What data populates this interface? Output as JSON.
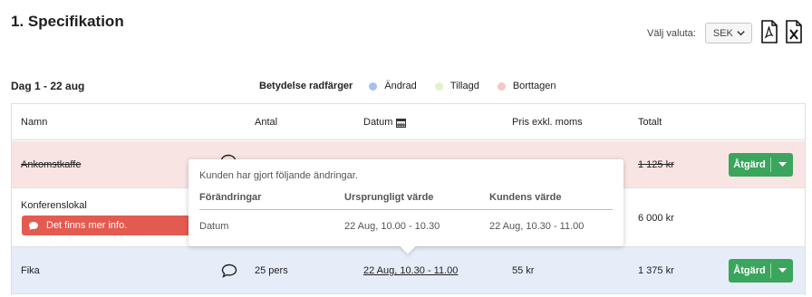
{
  "header": {
    "title": "1. Specifikation",
    "currency_label": "Välj valuta:",
    "currency_value": "SEK",
    "pdf_icon": "pdf-file-icon",
    "excel_icon": "excel-file-icon"
  },
  "period": "Dag 1 - 22 aug",
  "legend": {
    "title": "Betydelse radfärger",
    "items": [
      {
        "label": "Ändrad",
        "color": "#a9bff0"
      },
      {
        "label": "Tillagd",
        "color": "#dff5c8"
      },
      {
        "label": "Borttagen",
        "color": "#f5c6c6"
      }
    ]
  },
  "table": {
    "headers": {
      "name": "Namn",
      "quantity": "Antal",
      "date": "Datum",
      "price": "Pris exkl. moms",
      "total": "Totalt"
    },
    "rows": [
      {
        "name": "Ankomstkaffe",
        "quantity": "",
        "date": "",
        "price": "",
        "total": "1 125 kr",
        "action": "Åtgärd",
        "status": "removed"
      },
      {
        "name": "Konferenslokal",
        "info": "Det finns mer info.",
        "quantity": "",
        "date": "",
        "price": "",
        "total": "6 000 kr",
        "status": "normal"
      },
      {
        "name": "Fika",
        "quantity": "25 pers",
        "date": "22 Aug, 10.30 - 11.00",
        "price": "55 kr",
        "total": "1 375 kr",
        "action": "Åtgärd",
        "status": "changed"
      }
    ]
  },
  "popover": {
    "title": "Kunden har gjort följande ändringar.",
    "headers": {
      "change": "Förändringar",
      "original": "Ursprungligt värde",
      "customer": "Kundens värde"
    },
    "row": {
      "change": "Datum",
      "original": "22 Aug, 10.00 - 10.30",
      "customer": "22 Aug, 10.30 - 11.00"
    }
  },
  "colors": {
    "removed_row": "#f9e4e4",
    "changed_row": "#e6ecf8",
    "action_button": "#3aa55c",
    "info_badge": "#e35b50"
  }
}
